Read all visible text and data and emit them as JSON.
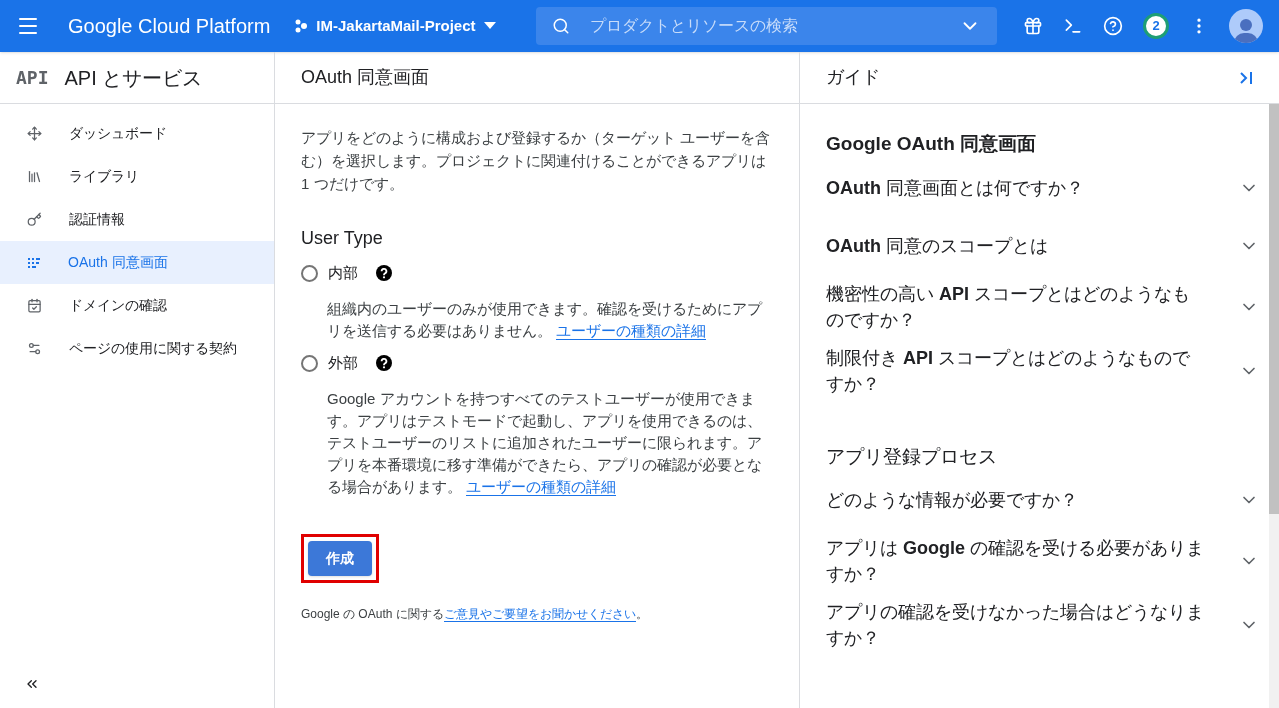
{
  "topbar": {
    "product": "Google Cloud Platform",
    "project": "IM-JakartaMail-Project",
    "search": {
      "placeholder": "プロダクトとリソースの検索"
    },
    "notifications": "2"
  },
  "sidebar": {
    "logo": "API",
    "title": "API とサービス",
    "items": [
      {
        "label": "ダッシュボード",
        "selected": false
      },
      {
        "label": "ライブラリ",
        "selected": false
      },
      {
        "label": "認証情報",
        "selected": false
      },
      {
        "label": "OAuth 同意画面",
        "selected": true
      },
      {
        "label": "ドメインの確認",
        "selected": false
      },
      {
        "label": "ページの使用に関する契約",
        "selected": false
      }
    ]
  },
  "main": {
    "title": "OAuth 同意画面",
    "intro": "アプリをどのように構成および登録するか（ターゲット ユーザーを含む）を選択します。プロジェクトに関連付けることができるアプリは 1 つだけです。",
    "user_type_heading": "User Type",
    "options": [
      {
        "label": "内部",
        "selected": false,
        "description": "組織内のユーザーのみが使用できます。確認を受けるためにアプリを送信する必要はありません。",
        "link": "ユーザーの種類の詳細"
      },
      {
        "label": "外部",
        "selected": false,
        "description": "Google アカウントを持つすべてのテストユーザーが使用できます。アプリはテストモードで起動し、アプリを使用できるのは、テストユーザーのリストに追加されたユーザーに限られます。アプリを本番環境に移す準備ができたら、アプリの確認が必要となる場合があります。",
        "link": "ユーザーの種類の詳細"
      }
    ],
    "create_button": {
      "label": "作成",
      "highlighted": true
    },
    "feedback": {
      "text": "Google の OAuth に関する",
      "link": "ご意見やご要望をお聞かせください",
      "end": "。"
    }
  },
  "guide": {
    "title": "ガイド",
    "sections": [
      {
        "heading": "Google OAuth 同意画面",
        "items": [
          {
            "label": "**OAuth** 同意画面とは何ですか？",
            "expanded": false
          },
          {
            "label": "**OAuth** 同意のスコープとは",
            "expanded": false
          },
          {
            "label": "機密性の高い **API** スコープとはどのようなものですか？",
            "expanded": false
          },
          {
            "label": "制限付き **API** スコープとはどのようなものですか？",
            "expanded": false
          }
        ]
      },
      {
        "heading": "アプリ登録プロセス",
        "items": [
          {
            "label": "どのような情報が必要ですか？",
            "expanded": false
          },
          {
            "label": "アプリは **Google** の確認を受ける必要がありますか？",
            "expanded": false
          },
          {
            "label": "アプリの確認を受けなかった場合はどうなりますか？",
            "expanded": false
          }
        ]
      }
    ]
  }
}
